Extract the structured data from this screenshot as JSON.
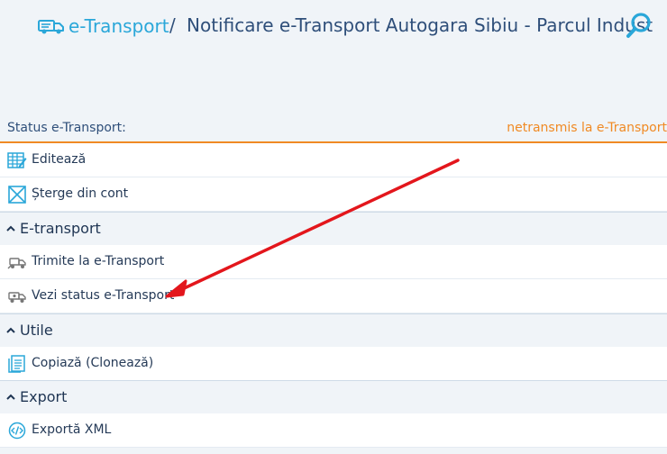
{
  "header": {
    "brand_label": "e-Transport",
    "separator": "/",
    "title": "Notificare e-Transport Autogara Sibiu - Parcul Indust",
    "brand_icon": "truck-icon",
    "search_icon": "search-icon"
  },
  "status": {
    "label": "Status e-Transport:",
    "value": "netransmis la e-Transport"
  },
  "actions": [
    {
      "label": "Editează",
      "icon": "edit-grid-icon"
    },
    {
      "label": "Șterge din cont",
      "icon": "delete-box-icon"
    }
  ],
  "sections": [
    {
      "title": "E-transport",
      "items": [
        {
          "label": "Trimite la e-Transport",
          "icon": "send-truck-icon"
        },
        {
          "label": "Vezi status e-Transport",
          "icon": "view-status-truck-icon"
        }
      ]
    },
    {
      "title": "Utile",
      "items": [
        {
          "label": "Copiază (Clonează)",
          "icon": "copy-document-icon"
        }
      ]
    },
    {
      "title": "Export",
      "items": [
        {
          "label": "Exportă XML",
          "icon": "xml-export-icon"
        }
      ]
    }
  ],
  "colors": {
    "brand": "#2aa7d9",
    "title": "#2f4f7a",
    "status_value": "#f08a24",
    "annotation_arrow": "#e3161c"
  }
}
